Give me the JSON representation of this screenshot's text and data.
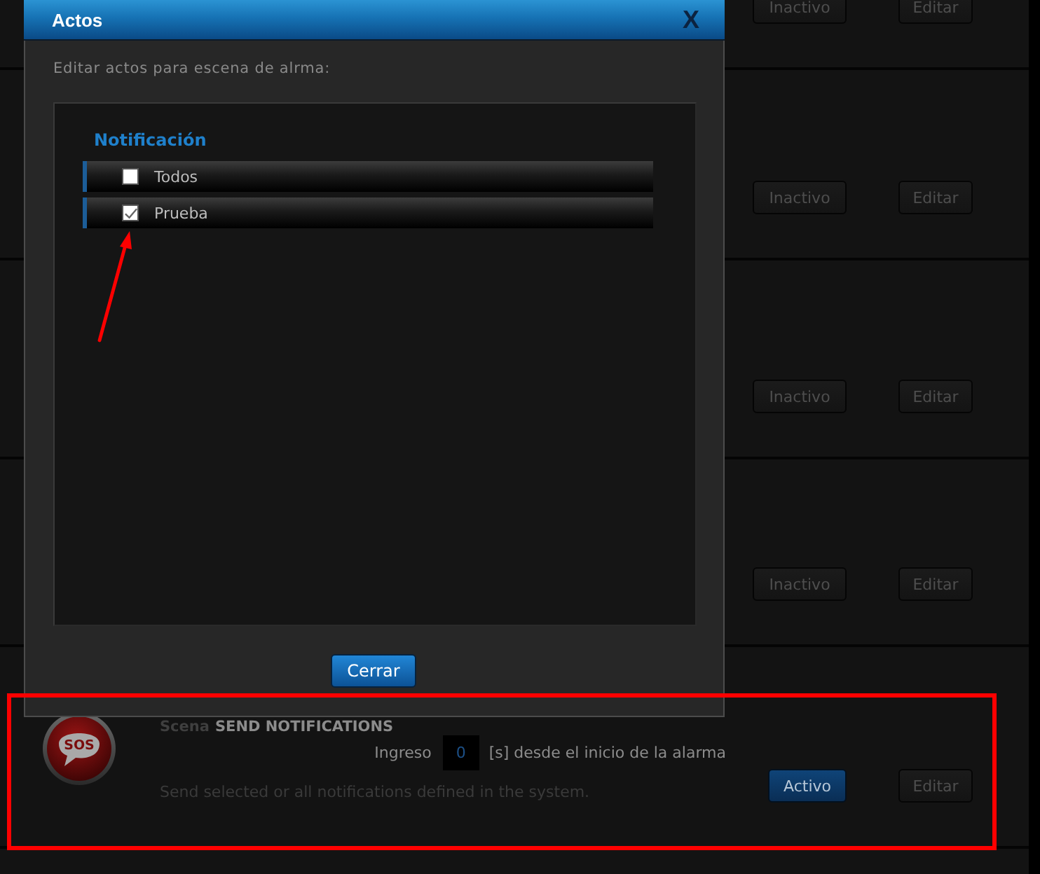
{
  "scenes": [
    {
      "status": "Inactivo",
      "active": false,
      "edit": "Editar",
      "highlighted": false
    },
    {
      "status": "Inactivo",
      "active": false,
      "edit": "Editar",
      "highlighted": false
    },
    {
      "status": "Inactivo",
      "active": false,
      "edit": "Editar",
      "highlighted": false
    },
    {
      "status": "Inactivo",
      "active": false,
      "edit": "Editar",
      "highlighted": false
    },
    {
      "icon_text": "SOS",
      "prefix": "Scena",
      "name": "SEND NOTIFICATIONS",
      "delay_label": "Ingreso",
      "delay_value": "0",
      "delay_unit": "[s] desde el inicio de la alarma",
      "description": "Send selected or all notifications defined in the system.",
      "status": "Activo",
      "active": true,
      "edit": "Editar",
      "highlighted": true
    }
  ],
  "dialog": {
    "title": "Actos",
    "close": "X",
    "subtitle": "Editar actos para escena de alrma:",
    "group": {
      "heading": "Notificación",
      "items": [
        {
          "label": "Todos",
          "checked": false,
          "pointed_at": false
        },
        {
          "label": "Prueba",
          "checked": true,
          "pointed_at": true
        }
      ]
    },
    "button": "Cerrar"
  }
}
